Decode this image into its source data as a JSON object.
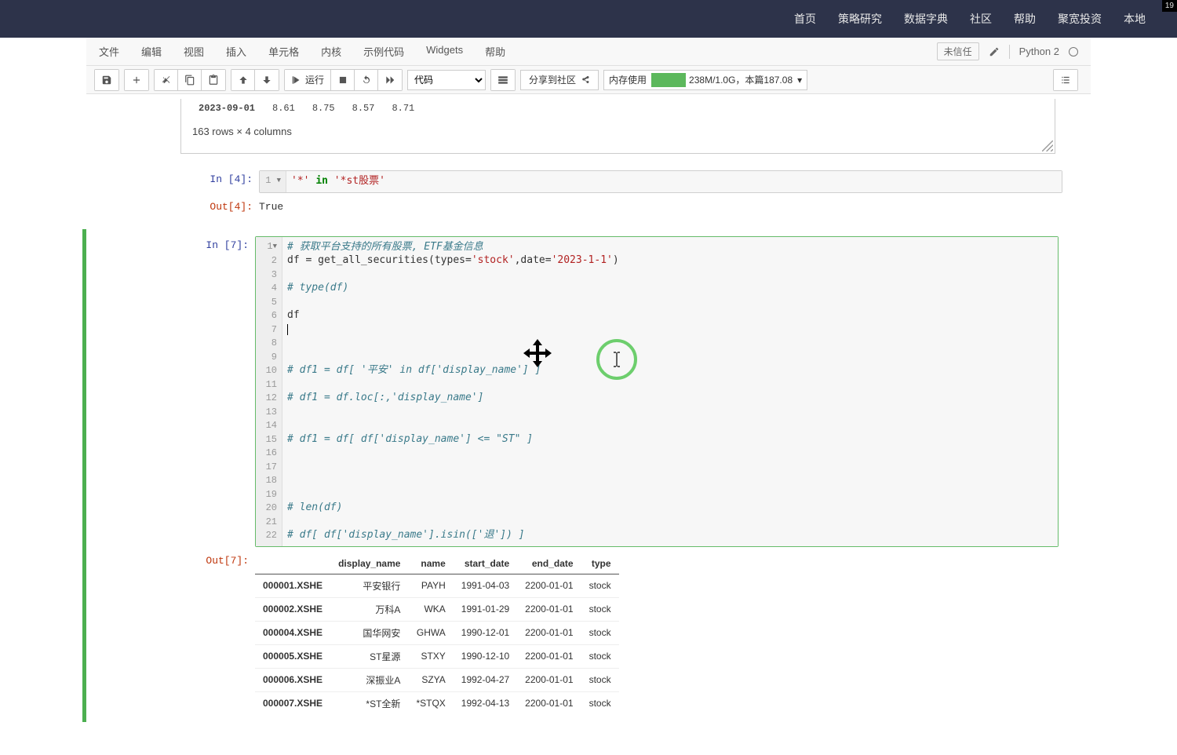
{
  "topnav": {
    "items": [
      "首页",
      "策略研究",
      "数据字典",
      "社区",
      "帮助",
      "聚宽投资",
      "本地"
    ],
    "badge": "19"
  },
  "menubar": {
    "items": [
      "文件",
      "编辑",
      "视图",
      "插入",
      "单元格",
      "内核",
      "示例代码",
      "Widgets",
      "帮助"
    ],
    "trusted": "未信任",
    "kernel": "Python 2"
  },
  "toolbar": {
    "run_label": "运行",
    "celltype": "代码",
    "share_label": "分享到社区",
    "mem_label": "内存使用",
    "mem_text": "238M/1.0G，本篇187.08"
  },
  "prev_output": {
    "row_label": "2023-09-01",
    "values": [
      "8.61",
      "8.75",
      "8.57",
      "8.71"
    ],
    "shape": "163 rows × 4 columns"
  },
  "cell4": {
    "in_label": "In [4]:",
    "out_label": "Out[4]:",
    "out_value": "True"
  },
  "cell7": {
    "in_label": "In [7]:",
    "code_lines": [
      {
        "t": "comment",
        "v": "# 获取平台支持的所有股票, ETF基金信息"
      },
      {
        "t": "code",
        "v": "df = get_all_securities(types=<s>'stock'</s>,date=<s>'2023-1-1'</s>)"
      },
      {
        "t": "blank",
        "v": ""
      },
      {
        "t": "comment",
        "v": "# type(df)"
      },
      {
        "t": "blank",
        "v": ""
      },
      {
        "t": "code",
        "v": "df"
      },
      {
        "t": "cursor",
        "v": ""
      },
      {
        "t": "blank",
        "v": ""
      },
      {
        "t": "blank",
        "v": ""
      },
      {
        "t": "comment",
        "v": "# df1 = df[ '平安' in df['display_name'] ]"
      },
      {
        "t": "blank",
        "v": ""
      },
      {
        "t": "comment",
        "v": "# df1 = df.loc[:,'display_name']"
      },
      {
        "t": "blank",
        "v": ""
      },
      {
        "t": "blank",
        "v": ""
      },
      {
        "t": "comment",
        "v": "# df1 = df[ df['display_name'] <= \"ST\" ]"
      },
      {
        "t": "blank",
        "v": ""
      },
      {
        "t": "blank",
        "v": ""
      },
      {
        "t": "blank",
        "v": ""
      },
      {
        "t": "blank",
        "v": ""
      },
      {
        "t": "comment",
        "v": "# len(df)"
      },
      {
        "t": "blank",
        "v": ""
      },
      {
        "t": "comment",
        "v": "# df[ df['display_name'].isin(['退']) ]"
      }
    ],
    "out_label": "Out[7]:"
  },
  "df_table": {
    "columns": [
      "display_name",
      "name",
      "start_date",
      "end_date",
      "type"
    ],
    "rows": [
      {
        "idx": "000001.XSHE",
        "c": [
          "平安银行",
          "PAYH",
          "1991-04-03",
          "2200-01-01",
          "stock"
        ]
      },
      {
        "idx": "000002.XSHE",
        "c": [
          "万科A",
          "WKA",
          "1991-01-29",
          "2200-01-01",
          "stock"
        ]
      },
      {
        "idx": "000004.XSHE",
        "c": [
          "国华网安",
          "GHWA",
          "1990-12-01",
          "2200-01-01",
          "stock"
        ]
      },
      {
        "idx": "000005.XSHE",
        "c": [
          "ST星源",
          "STXY",
          "1990-12-10",
          "2200-01-01",
          "stock"
        ]
      },
      {
        "idx": "000006.XSHE",
        "c": [
          "深振业A",
          "SZYA",
          "1992-04-27",
          "2200-01-01",
          "stock"
        ]
      },
      {
        "idx": "000007.XSHE",
        "c": [
          "*ST全新",
          "*STQX",
          "1992-04-13",
          "2200-01-01",
          "stock"
        ]
      }
    ]
  }
}
